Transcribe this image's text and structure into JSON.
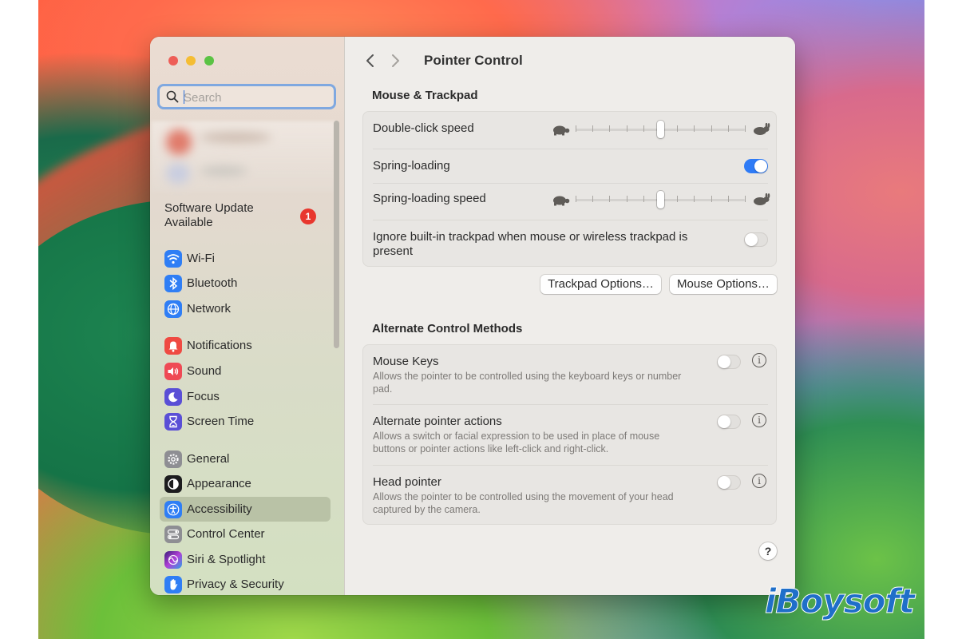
{
  "watermark": "iBoysoft",
  "sidebar": {
    "search_placeholder": "Search",
    "software_update": "Software Update Available",
    "update_badge": "1",
    "items": [
      {
        "label": "Wi-Fi",
        "icon": "wifi-icon",
        "color": "#2f7ef5"
      },
      {
        "label": "Bluetooth",
        "icon": "bluetooth-icon",
        "color": "#2f7ef5"
      },
      {
        "label": "Network",
        "icon": "globe-icon",
        "color": "#2f7ef5"
      },
      {
        "label": "Notifications",
        "icon": "bell-icon",
        "color": "#ef4a42"
      },
      {
        "label": "Sound",
        "icon": "speaker-icon",
        "color": "#ef4a55"
      },
      {
        "label": "Focus",
        "icon": "moon-icon",
        "color": "#5a4fd6"
      },
      {
        "label": "Screen Time",
        "icon": "hourglass-icon",
        "color": "#5a4fd6"
      },
      {
        "label": "General",
        "icon": "gear-icon",
        "color": "#8e8e93"
      },
      {
        "label": "Appearance",
        "icon": "appearance-icon",
        "color": "#1c1c1e"
      },
      {
        "label": "Accessibility",
        "icon": "accessibility-icon",
        "color": "#2f7ef5"
      },
      {
        "label": "Control Center",
        "icon": "control-center-icon",
        "color": "#8e8e93"
      },
      {
        "label": "Siri & Spotlight",
        "icon": "siri-icon",
        "color": "#7a3fd6"
      },
      {
        "label": "Privacy & Security",
        "icon": "hand-icon",
        "color": "#2f7ef5"
      }
    ],
    "selected": "Accessibility"
  },
  "main": {
    "title": "Pointer Control",
    "section1": {
      "heading": "Mouse & Trackpad",
      "double_click_label": "Double-click speed",
      "double_click_value": 0.5,
      "spring_loading_label": "Spring-loading",
      "spring_loading_on": true,
      "spring_speed_label": "Spring-loading speed",
      "spring_speed_value": 0.5,
      "ignore_trackpad_label": "Ignore built-in trackpad when mouse or wireless trackpad is present",
      "ignore_trackpad_on": false
    },
    "buttons": {
      "trackpad_options": "Trackpad Options…",
      "mouse_options": "Mouse Options…"
    },
    "section2": {
      "heading": "Alternate Control Methods",
      "items": [
        {
          "label": "Mouse Keys",
          "desc": "Allows the pointer to be controlled using the keyboard keys or number pad.",
          "on": false
        },
        {
          "label": "Alternate pointer actions",
          "desc": "Allows a switch or facial expression to be used in place of mouse buttons or pointer actions like left-click and right-click.",
          "on": false
        },
        {
          "label": "Head pointer",
          "desc": "Allows the pointer to be controlled using the movement of your head captured by the camera.",
          "on": false
        }
      ]
    },
    "help_label": "?"
  },
  "colors": {
    "accent": "#2e7bf6",
    "badge": "#e8372e"
  }
}
